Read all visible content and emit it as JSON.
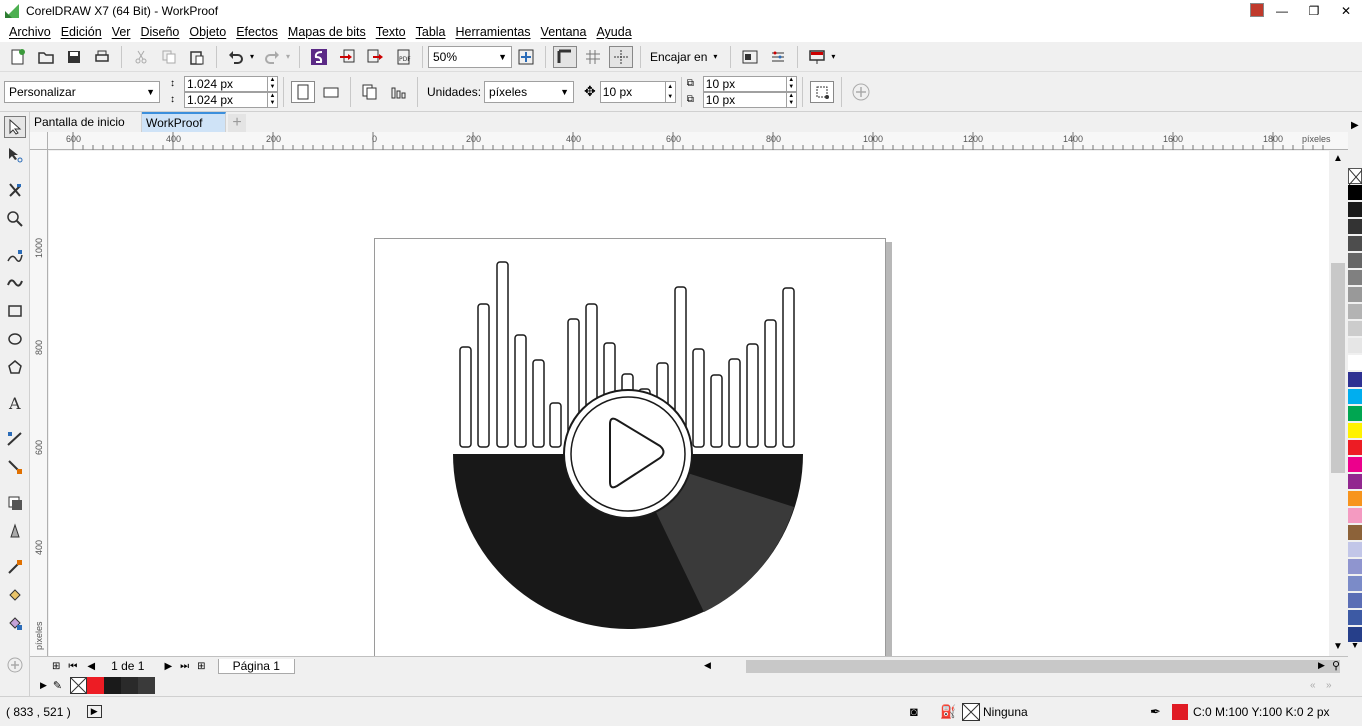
{
  "window": {
    "title": "CorelDRAW X7 (64 Bit) - WorkProof",
    "minimize": "—",
    "maximize": "❐",
    "close": "✕"
  },
  "menu": [
    "Archivo",
    "Edición",
    "Ver",
    "Diseño",
    "Objeto",
    "Efectos",
    "Mapas de bits",
    "Texto",
    "Tabla",
    "Herramientas",
    "Ventana",
    "Ayuda"
  ],
  "toolbar": {
    "zoom_value": "50%",
    "snap_label": "Encajar en"
  },
  "propbar": {
    "page_size_preset": "Personalizar",
    "width": "1.024 px",
    "height": "1.024 px",
    "units_label": "Unidades:",
    "units_value": "píxeles",
    "nudge": "10 px",
    "dup_x": "10 px",
    "dup_y": "10 px"
  },
  "doc_tabs": [
    {
      "label": "Pantalla de inicio",
      "active": false
    },
    {
      "label": "WorkProof",
      "active": true
    }
  ],
  "ruler_h": {
    "labels": [
      "600",
      "400",
      "200",
      "0",
      "200",
      "400",
      "600",
      "800",
      "1000",
      "1200",
      "1400",
      "1600",
      "1800"
    ],
    "unit": "píxeles"
  },
  "ruler_v": {
    "labels": [
      "1000",
      "800",
      "600",
      "400"
    ],
    "unit": "píxeles"
  },
  "page_nav": {
    "counter": "1 de 1",
    "page_tab": "Página 1"
  },
  "status": {
    "coords": "( 833  , 521  )",
    "fill_label": "Ninguna",
    "outline_label": "C:0 M:100 Y:100 K:0  2 px"
  },
  "colors": {
    "accent": "#3c8fdc",
    "record_dark": "#181818",
    "record_sheen": "#3a3a3a",
    "outline_red": "#e01b24"
  },
  "palette": [
    "#000000",
    "#1a1a1a",
    "#333333",
    "#4d4d4d",
    "#666666",
    "#808080",
    "#999999",
    "#b3b3b3",
    "#cccccc",
    "#e6e6e6",
    "#ffffff",
    "#2e3192",
    "#00aeef",
    "#00a651",
    "#fff200",
    "#ed1c24",
    "#ec008c",
    "#92278f",
    "#f7941d",
    "#f49ac1",
    "#8c6239",
    "#c2c6e8",
    "#8f95cf",
    "#7b8bc8",
    "#5b6eb5",
    "#3d5aa4",
    "#263f8a"
  ],
  "doc_palette": [
    "#ed1c24",
    "#1a1a1a",
    "#2a2a2a",
    "#3a3a3a"
  ]
}
